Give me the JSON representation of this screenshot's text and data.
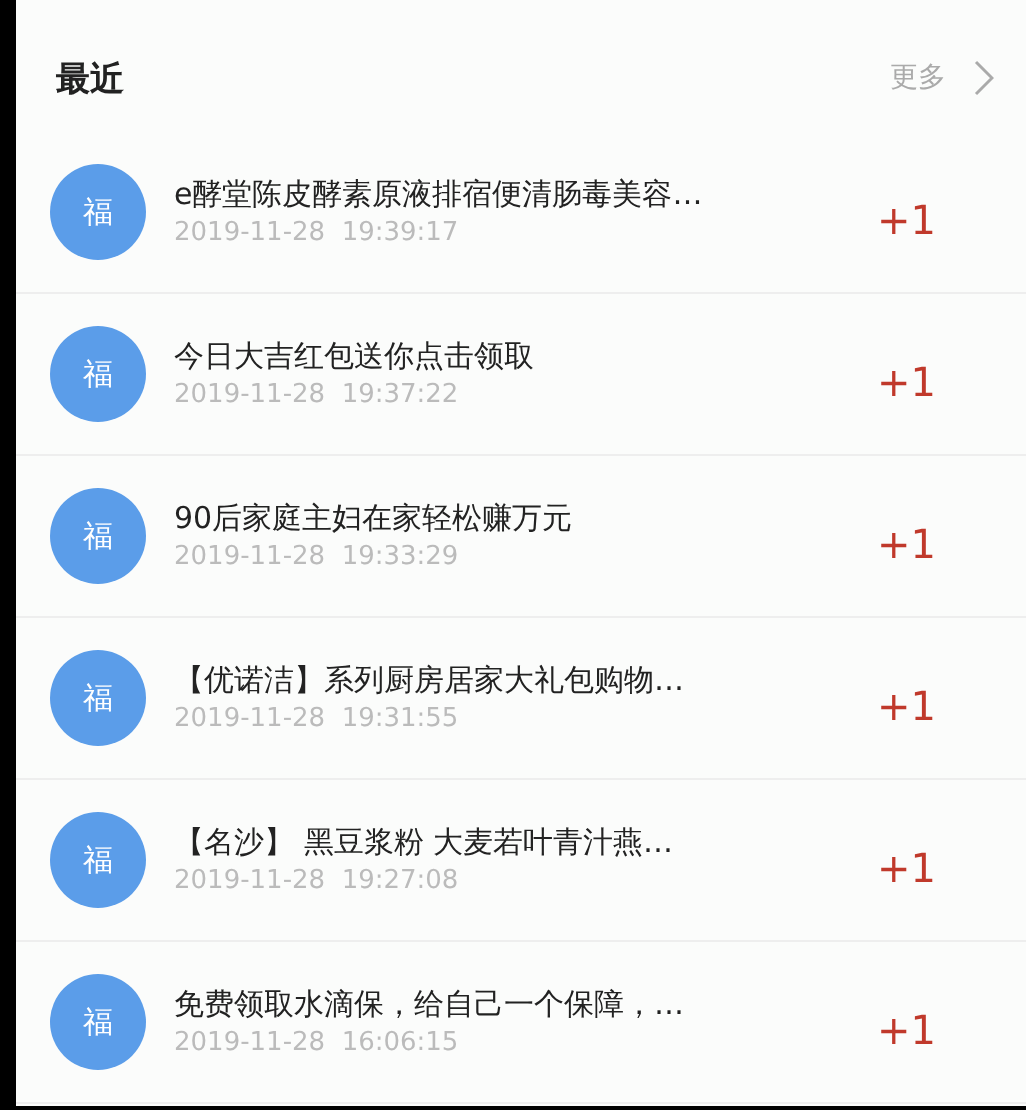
{
  "header": {
    "title": "最近",
    "more": "更多"
  },
  "items": [
    {
      "avatar": "福",
      "title": "e酵堂陈皮酵素原液排宿便清肠毒美容…",
      "time": "2019-11-28  19:39:17",
      "count": "+1"
    },
    {
      "avatar": "福",
      "title": "今日大吉红包送你点击领取",
      "time": "2019-11-28  19:37:22",
      "count": "+1"
    },
    {
      "avatar": "福",
      "title": "90后家庭主妇在家轻松赚万元",
      "time": "2019-11-28  19:33:29",
      "count": "+1"
    },
    {
      "avatar": "福",
      "title": "【优诺洁】系列厨房居家大礼包购物…",
      "time": "2019-11-28  19:31:55",
      "count": "+1"
    },
    {
      "avatar": "福",
      "title": "【名沙】 黑豆浆粉 大麦若叶青汁燕…",
      "time": "2019-11-28  19:27:08",
      "count": "+1"
    },
    {
      "avatar": "福",
      "title": "免费领取水滴保，给自己一个保障，…",
      "time": "2019-11-28  16:06:15",
      "count": "+1"
    }
  ]
}
